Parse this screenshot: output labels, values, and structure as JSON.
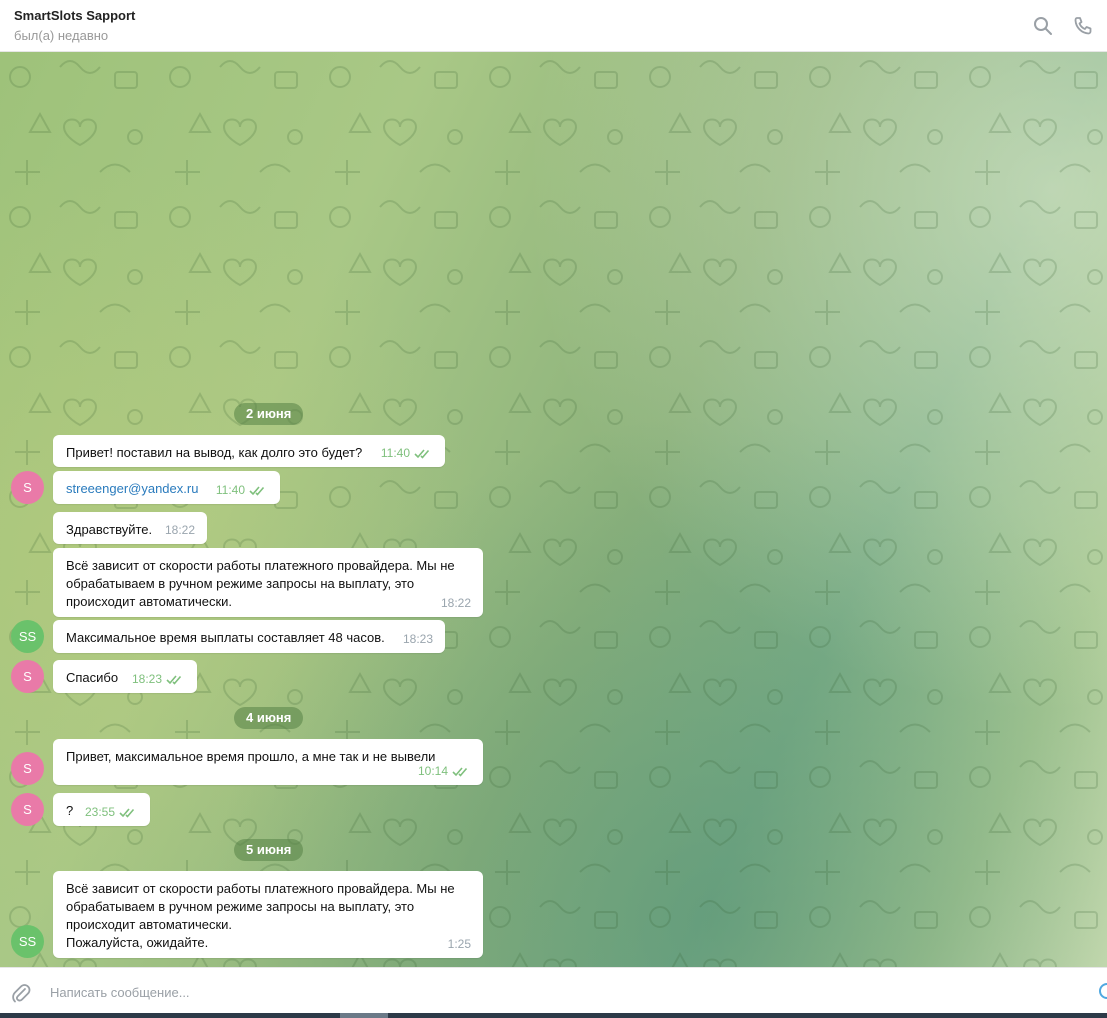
{
  "header": {
    "title": "SmartSlots Sapport",
    "status": "был(а) недавно",
    "icons": [
      "search-icon",
      "phone-icon"
    ]
  },
  "colors": {
    "bubble": "#ffffff",
    "avatar_pink": "#e97aa8",
    "avatar_green": "#6ac26b",
    "read_check": "#7fc07d",
    "link": "#2a7bbd"
  },
  "dates": [
    "2 июня",
    "4 июня",
    "5 июня"
  ],
  "messages": [
    {
      "text": "Привет! поставил на вывод, как долго это будет?",
      "time": "11:40",
      "read": true
    },
    {
      "text": "streeenger@yandex.ru",
      "time": "11:40",
      "read": true,
      "avatar": "S"
    },
    {
      "text": "Здравствуйте.",
      "time": "18:22"
    },
    {
      "text": "Всё зависит от скорости работы платежного провайдера. Мы не обрабатываем в ручном режиме запросы на выплату, это происходит автоматически.",
      "time": "18:22"
    },
    {
      "text": "Максимальное время выплаты составляет 48 часов.",
      "time": "18:23",
      "avatar": "SS"
    },
    {
      "text": "Спасибо",
      "time": "18:23",
      "read": true,
      "avatar": "S"
    },
    {
      "text": "Привет, максимальное время прошло, а мне так и не вывели",
      "time": "10:14",
      "read": true,
      "avatar": "S"
    },
    {
      "text": "?",
      "time": "23:55",
      "read": true,
      "avatar": "S"
    },
    {
      "text": "Всё зависит от скорости работы платежного провайдера. Мы не обрабатываем в ручном режиме запросы на выплату, это происходит автоматически.\nПожалуйста, ожидайте.",
      "time": "1:25",
      "avatar": "SS"
    }
  ],
  "composer": {
    "placeholder": "Написать сообщение..."
  }
}
